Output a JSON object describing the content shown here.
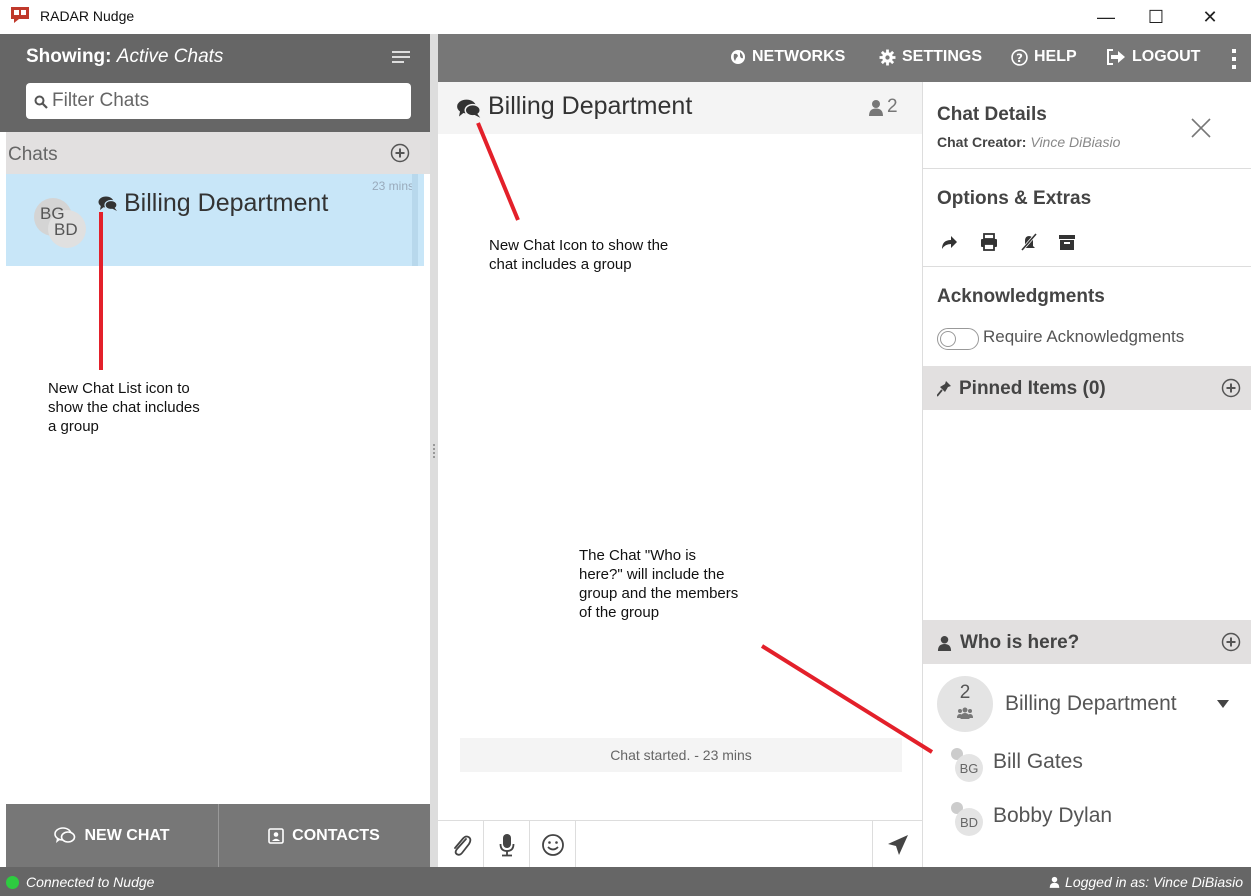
{
  "window": {
    "title": "RADAR Nudge",
    "controls": {
      "minimize": "—",
      "maximize": "☐",
      "close": "✕"
    }
  },
  "left_panel": {
    "showing_label": "Showing:",
    "showing_value": "Active Chats",
    "filter_placeholder": "Filter Chats",
    "chats_header": "Chats",
    "chat_list": [
      {
        "name": "Billing Department",
        "time": "23 mins",
        "avatars": [
          "BG",
          "BD"
        ],
        "icon": "group-chat-icon"
      }
    ],
    "bottom_tabs": {
      "new_chat": "NEW CHAT",
      "contacts": "CONTACTS"
    }
  },
  "top_nav": {
    "networks": "NETWORKS",
    "settings": "SETTINGS",
    "help": "HELP",
    "logout": "LOGOUT"
  },
  "chat": {
    "title": "Billing Department",
    "member_count": "2",
    "system_message": "Chat started. - 23 mins",
    "input_placeholder": ""
  },
  "details": {
    "title": "Chat Details",
    "creator_label": "Chat Creator:",
    "creator_name": "Vince DiBiasio",
    "options_title": "Options & Extras",
    "options_icons": [
      "forward-icon",
      "print-icon",
      "mute-icon",
      "archive-icon"
    ],
    "ack_title": "Acknowledgments",
    "ack_toggle_label": "Require Acknowledgments",
    "ack_toggle_on": false,
    "pinned_title": "Pinned Items (0)",
    "who_title": "Who is here?",
    "group": {
      "count": "2",
      "name": "Billing Department"
    },
    "members": [
      {
        "initials": "BG",
        "name": "Bill Gates"
      },
      {
        "initials": "BD",
        "name": "Bobby Dylan"
      }
    ]
  },
  "status_bar": {
    "connection": "Connected to Nudge",
    "logged_in": "Logged in as: Vince DiBiasio",
    "connection_color": "#2ecc40"
  },
  "annotations": {
    "chat_list_icon": [
      "New Chat List icon to",
      "show the chat includes",
      "a group"
    ],
    "chat_icon": [
      "New Chat Icon to show the",
      "chat includes a group"
    ],
    "who_is_here": [
      "The Chat \"Who is",
      "here?\" will include the",
      "group and the members",
      "of the group"
    ],
    "line_color": "#e3202a"
  },
  "colors": {
    "header_gray": "#666666",
    "nav_gray": "#777777",
    "selected_chat": "#c8e6f8",
    "section_bar": "#e2e0e0"
  }
}
